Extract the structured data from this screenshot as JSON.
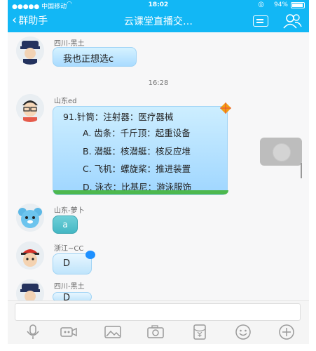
{
  "status_bar": {
    "carrier": "●●●●● 中国移动 ",
    "time": "18:02",
    "battery": "94%"
  },
  "nav": {
    "back_label": "群助手",
    "title": "云课堂直播交…"
  },
  "messages": [
    {
      "sender": "四川-黑土",
      "text": "我也正想选c"
    },
    {
      "timestamp": "16:28"
    },
    {
      "sender": "山东ed",
      "question": "91.针筒：注射器：医疗器械",
      "options": [
        "A. 齿条：千斤顶：起重设备",
        "B. 潜艇：核潜艇：核反应堆",
        "C. 飞机：螺旋桨：推进装置",
        "D. 泳衣：比基尼：游泳服饰"
      ]
    },
    {
      "sender": "山东-萝卜",
      "text": "a"
    },
    {
      "sender": "浙江~CC",
      "text": "D"
    },
    {
      "sender": "四川-黑土",
      "text": "D"
    }
  ],
  "icons": [
    "back-chevron-icon",
    "profile-card-icon",
    "group-members-icon",
    "voice-icon",
    "video-icon",
    "image-icon",
    "camera-icon",
    "red-packet-icon",
    "emoji-icon",
    "plus-icon"
  ],
  "colors": {
    "nav_bg": "#12b7f5",
    "bubble": "#a9dbff"
  }
}
